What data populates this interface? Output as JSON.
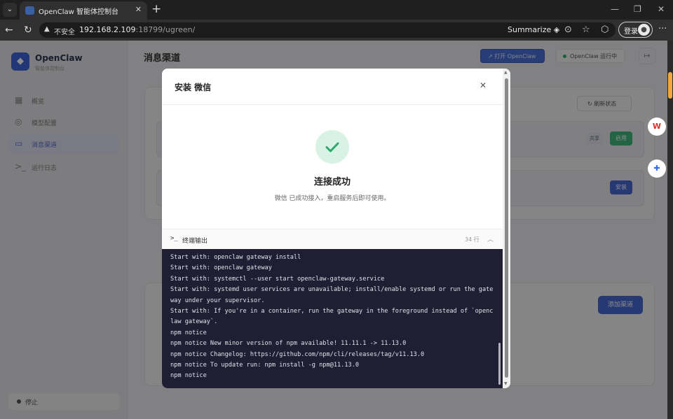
{
  "browser": {
    "tab_title": "OpenClaw 智能体控制台",
    "tab_close": "✕",
    "new_tab": "+",
    "security_label": "不安全",
    "url_host": "192.168.2.109",
    "url_path": ":18799/ugreen/",
    "summarize_label": "Summarize",
    "login_label": "登录",
    "more": "···",
    "minimize": "—",
    "restore": "❐",
    "close": "✕",
    "back": "←",
    "reload": "↻"
  },
  "sidebar": {
    "brand": "OpenClaw",
    "brand_sub": "智能体控制台",
    "items": [
      {
        "label": "概览",
        "icon": "▦"
      },
      {
        "label": "模型配置",
        "icon": "◎"
      },
      {
        "label": "消息渠道",
        "icon": "▭"
      },
      {
        "label": "运行日志",
        "icon": ">_"
      }
    ],
    "stop_label": "停止"
  },
  "topbar": {
    "title": "消息渠道",
    "open_label": "↗ 打开 OpenClaw",
    "status_label": "OpenClaw 运行中",
    "exit_icon": "↦"
  },
  "content": {
    "refresh_label": "↻ 刷新状态",
    "tag_shared": "共享",
    "tag_enabled": "启用",
    "tag_install": "安装",
    "add_channel": "添加渠道"
  },
  "modal": {
    "title": "安装 微信",
    "close": "✕",
    "success_title": "连接成功",
    "success_desc": "微信 已成功接入，重启服务后即可使用。",
    "terminal_icon": ">_",
    "terminal_label": "终端输出",
    "line_count": "34 行",
    "collapse_icon": "︿",
    "terminal_lines": [
      "Start with: openclaw gateway install",
      "Start with: openclaw gateway",
      "Start with: systemctl --user start openclaw-gateway.service",
      "Start with: systemd user services are unavailable; install/enable systemd or run the gateway under your supervisor.",
      "Start with: If you're in a container, run the gateway in the foreground instead of `openclaw gateway`.",
      "npm notice",
      "npm notice New minor version of npm available! 11.11.1 -> 11.13.0",
      "npm notice Changelog: https://github.com/npm/cli/releases/tag/v11.13.0",
      "npm notice To update run: npm install -g npm@11.13.0",
      "npm notice"
    ]
  },
  "colors": {
    "accent": "#4868d0",
    "success": "#2ea96a",
    "terminal_bg": "#1f1e33"
  }
}
